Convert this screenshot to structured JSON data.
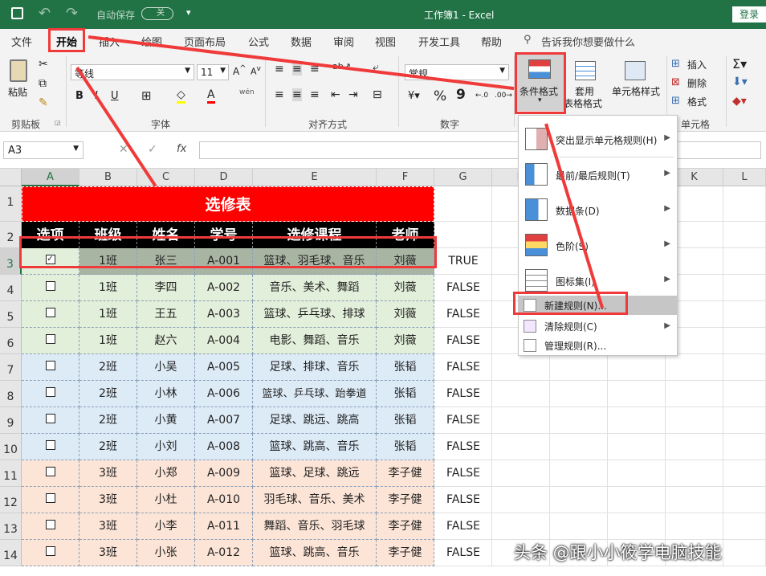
{
  "titlebar": {
    "autosave_label": "自动保存",
    "autosave_state": "关",
    "title": "工作簿1 - Excel",
    "login": "登录"
  },
  "tabs": [
    "文件",
    "开始",
    "插入",
    "绘图",
    "页面布局",
    "公式",
    "数据",
    "审阅",
    "视图",
    "开发工具",
    "帮助"
  ],
  "tell_me": "告诉我你想要做什么",
  "ribbon": {
    "paste": "粘贴",
    "clipboard": "剪贴板",
    "font_name": "等线",
    "font_size": "11",
    "font_group": "字体",
    "align_group": "对齐方式",
    "number_format": "常规",
    "number_group": "数字",
    "cond_format": "条件格式",
    "table_format_1": "套用",
    "table_format_2": "表格格式",
    "cell_styles": "单元格样式",
    "insert": "插入",
    "delete": "删除",
    "format": "格式",
    "cells_group": "单元格",
    "bold": "B",
    "italic": "I",
    "underline": "U",
    "percent": "%",
    "comma": "9"
  },
  "formula_bar": {
    "name_box": "A3",
    "fx": "fx"
  },
  "columns": [
    "A",
    "B",
    "C",
    "D",
    "E",
    "F",
    "G",
    "H",
    "I",
    "J",
    "K",
    "L"
  ],
  "rows": [
    "1",
    "2",
    "3",
    "4",
    "5",
    "6",
    "7",
    "8",
    "9",
    "10",
    "11",
    "12",
    "13",
    "14"
  ],
  "table": {
    "title": "选修表",
    "headers": [
      "选项",
      "班级",
      "姓名",
      "学号",
      "选修课程",
      "老师"
    ],
    "data": [
      {
        "checked": true,
        "class": "1班",
        "name": "张三",
        "id": "A-001",
        "course": "篮球、羽毛球、音乐",
        "teacher": "刘薇",
        "flag": "TRUE"
      },
      {
        "checked": false,
        "class": "1班",
        "name": "李四",
        "id": "A-002",
        "course": "音乐、美术、舞蹈",
        "teacher": "刘薇",
        "flag": "FALSE"
      },
      {
        "checked": false,
        "class": "1班",
        "name": "王五",
        "id": "A-003",
        "course": "篮球、乒乓球、排球",
        "teacher": "刘薇",
        "flag": "FALSE"
      },
      {
        "checked": false,
        "class": "1班",
        "name": "赵六",
        "id": "A-004",
        "course": "电影、舞蹈、音乐",
        "teacher": "刘薇",
        "flag": "FALSE"
      },
      {
        "checked": false,
        "class": "2班",
        "name": "小吴",
        "id": "A-005",
        "course": "足球、排球、音乐",
        "teacher": "张韬",
        "flag": "FALSE"
      },
      {
        "checked": false,
        "class": "2班",
        "name": "小林",
        "id": "A-006",
        "course": "篮球、乒乓球、跆拳道",
        "teacher": "张韬",
        "flag": "FALSE"
      },
      {
        "checked": false,
        "class": "2班",
        "name": "小黄",
        "id": "A-007",
        "course": "足球、跳远、跳高",
        "teacher": "张韬",
        "flag": "FALSE"
      },
      {
        "checked": false,
        "class": "2班",
        "name": "小刘",
        "id": "A-008",
        "course": "篮球、跳高、音乐",
        "teacher": "张韬",
        "flag": "FALSE"
      },
      {
        "checked": false,
        "class": "3班",
        "name": "小郑",
        "id": "A-009",
        "course": "篮球、足球、跳远",
        "teacher": "李子健",
        "flag": "FALSE"
      },
      {
        "checked": false,
        "class": "3班",
        "name": "小杜",
        "id": "A-010",
        "course": "羽毛球、音乐、美术",
        "teacher": "李子健",
        "flag": "FALSE"
      },
      {
        "checked": false,
        "class": "3班",
        "name": "小李",
        "id": "A-011",
        "course": "舞蹈、音乐、羽毛球",
        "teacher": "李子健",
        "flag": "FALSE"
      },
      {
        "checked": false,
        "class": "3班",
        "name": "小张",
        "id": "A-012",
        "course": "篮球、跳高、音乐",
        "teacher": "李子健",
        "flag": "FALSE"
      }
    ]
  },
  "menu": {
    "items": [
      {
        "label": "突出显示单元格规则(H)",
        "icon": "highlight-rules-icon",
        "sub": true
      },
      {
        "label": "最前/最后规则(T)",
        "icon": "top-bottom-rules-icon",
        "sub": true
      },
      {
        "label": "数据条(D)",
        "icon": "data-bars-icon",
        "sub": true
      },
      {
        "label": "色阶(S)",
        "icon": "color-scales-icon",
        "sub": true
      },
      {
        "label": "图标集(I)",
        "icon": "icon-sets-icon",
        "sub": true
      },
      {
        "label": "新建规则(N)...",
        "icon": "new-rule-icon",
        "sub": false
      },
      {
        "label": "清除规则(C)",
        "icon": "clear-rules-icon",
        "sub": true
      },
      {
        "label": "管理规则(R)...",
        "icon": "manage-rules-icon",
        "sub": false
      }
    ]
  },
  "watermark": "头条 @跟小小筱学电脑技能",
  "colors": {
    "green": "#217346",
    "red_title": "#ff0000",
    "row_green": "#e2efda",
    "row_blue": "#ddebf7",
    "row_peach": "#fce4d6",
    "selected_row": "#a9b5a3",
    "annot": "#f03a3a"
  }
}
